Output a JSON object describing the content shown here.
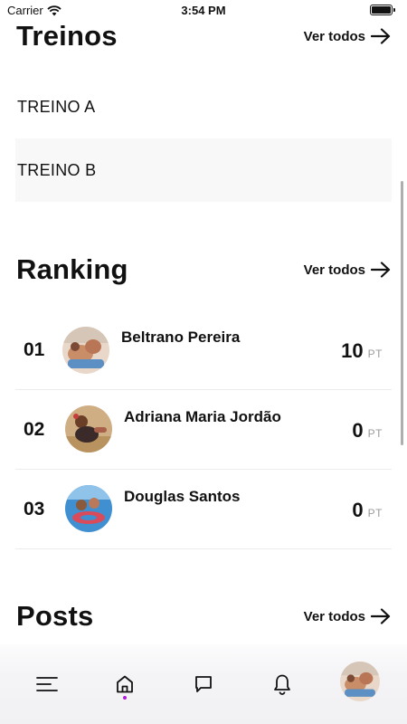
{
  "status_bar": {
    "carrier": "Carrier",
    "time": "3:54 PM"
  },
  "workouts": {
    "title": "Treinos",
    "see_all": "Ver todos",
    "items": [
      {
        "label": "TREINO A"
      },
      {
        "label": "TREINO B"
      }
    ]
  },
  "ranking": {
    "title": "Ranking",
    "see_all": "Ver todos",
    "items": [
      {
        "position": "01",
        "name": "Beltrano Pereira",
        "score": "10",
        "unit": "PT"
      },
      {
        "position": "02",
        "name": "Adriana Maria Jordão",
        "score": "0",
        "unit": "PT"
      },
      {
        "position": "03",
        "name": "Douglas Santos",
        "score": "0",
        "unit": "PT"
      }
    ]
  },
  "posts": {
    "title": "Posts",
    "see_all": "Ver todos"
  },
  "bottom_nav": {
    "items": [
      "menu-icon",
      "home-icon",
      "chat-icon",
      "bell-icon",
      "profile-avatar"
    ],
    "active": "home-icon",
    "active_color": "#b01bd9"
  }
}
